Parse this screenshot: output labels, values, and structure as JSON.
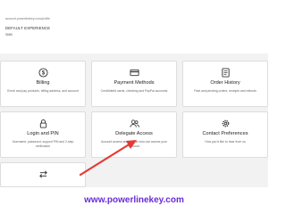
{
  "browser": {
    "url": "account.powerlinekey.com/profile",
    "account_name": "DEFAULT EXPERIENCE",
    "account_sub": "SMB"
  },
  "cards": [
    {
      "icon": "dollar-icon",
      "title": "Billing",
      "desc": "Enroll and pay products, billing address, and account"
    },
    {
      "icon": "credit-card-icon",
      "title": "Payment Methods",
      "desc": "Credit/debit cards, checking and PayPal accounts"
    },
    {
      "icon": "order-history-icon",
      "title": "Order History",
      "desc": "Past and pending orders, receipts and refunds"
    },
    {
      "icon": "lock-icon",
      "title": "Login and PIN",
      "desc": "Username, password, support PIN and 2-step verification"
    },
    {
      "icon": "people-icon",
      "title": "Delegate Access",
      "desc": "Account access and people who use access your account"
    },
    {
      "icon": "gear-icon",
      "title": "Contact Preferences",
      "desc": "How you'd like to hear from us"
    },
    {
      "icon": "transfer-icon",
      "title": "",
      "desc": ""
    }
  ],
  "footer": {
    "site": "www.powerlinekey.com"
  },
  "colors": {
    "footer_text": "#6a2bd6",
    "arrow": "#e53935"
  }
}
